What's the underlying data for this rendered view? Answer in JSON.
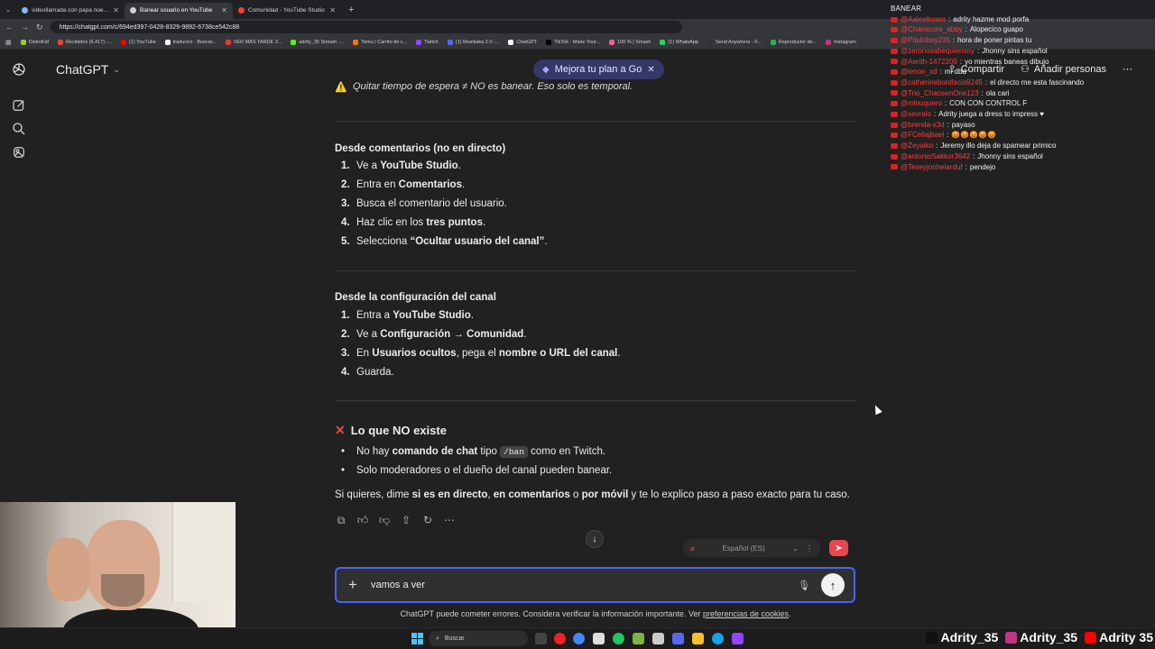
{
  "browser": {
    "tabs": [
      {
        "title": "videollamada con papá noel - Bus",
        "color": "#8ab4f8",
        "active": false
      },
      {
        "title": "Banear usuario en YouTube",
        "color": "#d0d0d0",
        "active": true
      },
      {
        "title": "Comunidad - YouTube Studio",
        "color": "#ff3b30",
        "active": false
      }
    ],
    "url": "https://chatgpt.com/c/694ed397-0428-8329-9892-6738ce542c88",
    "bookmarks": [
      {
        "label": "DistroKid",
        "color": "#9acd32"
      },
      {
        "label": "Recibidos (6.417) -...",
        "color": "#ea4335"
      },
      {
        "label": "(1) YouTube",
        "color": "#ff0000"
      },
      {
        "label": "traductor - Buscar...",
        "color": "#ffffff"
      },
      {
        "label": "VER MÁS TARDE 3...",
        "color": "#e53935"
      },
      {
        "label": "adrity_35 Stream -...",
        "color": "#53fc18"
      },
      {
        "label": "Temu | Carrito de c...",
        "color": "#fb7701"
      },
      {
        "label": "Twitch",
        "color": "#9146ff"
      },
      {
        "label": "(1) Musikaka 2.0 -...",
        "color": "#5865f2"
      },
      {
        "label": "ChatGPT",
        "color": "#ffffff"
      },
      {
        "label": "TikTok - Make Your...",
        "color": "#000000"
      },
      {
        "label": "100 % | Smash",
        "color": "#f06292"
      },
      {
        "label": "(1) WhatsApp",
        "color": "#25d366"
      },
      {
        "label": "Send Anywhere - F...",
        "color": "#333333"
      },
      {
        "label": "Reproductor de...",
        "color": "#1db954"
      },
      {
        "label": "Instagram",
        "color": "#c13584"
      }
    ]
  },
  "app": {
    "title": "ChatGPT",
    "upgrade_label": "Mejora tu plan a Go",
    "share_label": "Compartir",
    "add_people_label": "Añadir personas"
  },
  "conversation": {
    "warning_text": "Quitar tiempo de espera ≠ NO es banear. Eso solo es temporal.",
    "section1": {
      "title": "Desde comentarios (no en directo)",
      "items": [
        {
          "n": "1.",
          "pre": "Ve a ",
          "bold": "YouTube Studio",
          "post": "."
        },
        {
          "n": "2.",
          "pre": "Entra en ",
          "bold": "Comentarios",
          "post": "."
        },
        {
          "n": "3.",
          "pre": "Busca el comentario del usuario.",
          "bold": "",
          "post": ""
        },
        {
          "n": "4.",
          "pre": "Haz clic en los ",
          "bold": "tres puntos",
          "post": "."
        },
        {
          "n": "5.",
          "pre": "Selecciona ",
          "bold": "“Ocultar usuario del canal”",
          "post": "."
        }
      ]
    },
    "section2": {
      "title": "Desde la configuración del canal",
      "items": [
        {
          "n": "1.",
          "pre": "Entra a ",
          "bold": "YouTube Studio",
          "post": "."
        },
        {
          "n": "2.",
          "pre": "Ve a ",
          "bold": "Configuración → Comunidad",
          "post": "."
        },
        {
          "n": "3.",
          "pre": "En ",
          "bold": "Usuarios ocultos",
          "post": ", pega el ",
          "bold2": "nombre o URL del canal",
          "post2": "."
        },
        {
          "n": "4.",
          "pre": "Guarda.",
          "bold": "",
          "post": ""
        }
      ]
    },
    "section3": {
      "title": "Lo que NO existe",
      "bullet1_pre": "No hay ",
      "bullet1_bold": "comando de chat",
      "bullet1_mid": " tipo ",
      "bullet1_code": "/ban",
      "bullet1_post": " como en Twitch.",
      "bullet2": "Solo moderadores o el dueño del canal pueden banear."
    },
    "closing_pre": "Si quieres, dime ",
    "closing_b1": "si es en directo",
    "closing_mid1": ", ",
    "closing_b2": "en comentarios",
    "closing_mid2": " o ",
    "closing_b3": "por móvil",
    "closing_post": " y te lo explico paso a paso exacto para tu caso."
  },
  "translate": {
    "language": "Español (ES)"
  },
  "composer": {
    "value": "vamos a ver",
    "disclaimer_pre": "ChatGPT puede cometer errores. Considera verificar la información importante. Ver ",
    "disclaimer_link": "preferencias de cookies",
    "disclaimer_post": "."
  },
  "stream_chat": {
    "title": "BANEAR",
    "messages": [
      {
        "user": "@Aalexitoooo",
        "text": "adrity hazme mod porfa"
      },
      {
        "user": "@Chaoscore_abby",
        "text": "Alopecico guapo"
      },
      {
        "user": "@Pitufoboy235",
        "text": "hora de poner pintas tu"
      },
      {
        "user": "@zeronosabequiensoy",
        "text": "Jhonny sins español"
      },
      {
        "user": "@Aerith-1472209",
        "text": "yo mientras baneas dibujo"
      },
      {
        "user": "@lenon_xd",
        "text": "mi dbd"
      },
      {
        "user": "@catherinebonifacio9245",
        "text": "el directo me esta fascinando"
      },
      {
        "user": "@Trio_ChaosenOne123",
        "text": "ola cari"
      },
      {
        "user": "@mlouquero",
        "text": "CON CON CONTROL F"
      },
      {
        "user": "@sevralo",
        "text": "Adrity juega a dress to impress ♥"
      },
      {
        "user": "@brenda-x3d",
        "text": "payaso"
      },
      {
        "user": "@FCeliajbael",
        "text": "😡😡😡😡😡"
      },
      {
        "user": "@Zeyaiko",
        "text": "Jeremy illo deja de spamear primico"
      },
      {
        "user": "@antonioSakkor3642",
        "text": "Jhonny sins español"
      },
      {
        "user": "@Teseyjonhelarduf",
        "text": "pendejo"
      }
    ]
  },
  "taskbar": {
    "search_label": "Buscar"
  },
  "socials": [
    {
      "label": "Adrity_35",
      "color": "#111111"
    },
    {
      "label": "Adrity_35",
      "color": "#c13584"
    },
    {
      "label": "Adrity 35",
      "color": "#ff0000"
    }
  ]
}
